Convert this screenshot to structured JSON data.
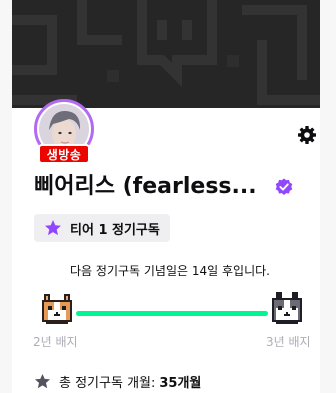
{
  "banner": {
    "icon": "twitch-glitch-pattern",
    "bg_color": "#262626"
  },
  "profile": {
    "avatar_icon": "avatar-photo",
    "ring_color": "#b26bf0",
    "live_label": "생방송",
    "live_color": "#eb0400",
    "name": "삐어리스 (fearless...",
    "verified_icon": "verified-icon",
    "settings_icon": "gear-icon"
  },
  "tier": {
    "label": "티어 1 정기구독",
    "icon": "star-icon",
    "accent": "#9147ff"
  },
  "anniversary": {
    "prefix": "다음 정기구독 기념일은 ",
    "days": "14일",
    "suffix": " 후입니다."
  },
  "badges": {
    "left_label": "2년 배지",
    "right_label": "3년 배지",
    "left_icon": "corgi-badge-icon",
    "right_icon": "husky-badge-icon",
    "progress": 1.0,
    "progress_color": "#00f593"
  },
  "total": {
    "label": "총 정기구독 개월:",
    "value": "35개월",
    "icon": "star-icon"
  }
}
